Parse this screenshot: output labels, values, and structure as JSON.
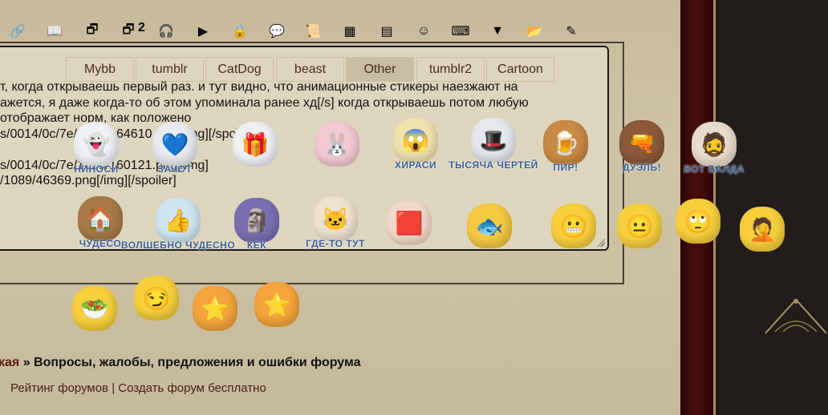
{
  "toolbar": {
    "icons": [
      "link-add-icon",
      "book-icon",
      "copy-icon",
      "copy-2-icon",
      "headphones-icon",
      "play-icon",
      "lock-icon",
      "speech-bubble-icon",
      "script-icon",
      "color-palette-icon",
      "table-icon",
      "smiley-icon",
      "keyboard-icon",
      "dropdown-arrow-icon",
      "folder-icon",
      "edit-image-icon"
    ],
    "glyphs": [
      "🔗",
      "📖",
      "🗗",
      "🗗",
      "🎧",
      "▶",
      "🔒",
      "💬",
      "📜",
      "▦",
      "▤",
      "☺",
      "⌨",
      "▼",
      "📂",
      "✎"
    ],
    "badge": "2"
  },
  "tabs": [
    {
      "label": "Mybb",
      "active": false
    },
    {
      "label": "tumblr",
      "active": false
    },
    {
      "label": "CatDog",
      "active": false
    },
    {
      "label": "beast",
      "active": false
    },
    {
      "label": "Other",
      "active": true
    },
    {
      "label": "tumblr2",
      "active": false
    },
    {
      "label": "Cartoon",
      "active": false
    }
  ],
  "editor": {
    "lines": [
      "т, когда открываешь первый раз. и тут видно, что анимационные стикеры наезжают на",
      "ажется, я даже когда-то об этом упоминала ранее хд[/s] когда открываешь потом любую",
      "отображает норм, как положено",
      "s/0014/0c/7e/1089/164610.png[/img][/spoiler]",
      "",
      "s/0014/0c/7e/1089/160121.png[/img]",
      "/1089/46369.png[/img][/spoiler]"
    ]
  },
  "stickers": [
    {
      "caption": "НИНОСИ",
      "glyph": "👻",
      "color": "#eef1f4"
    },
    {
      "caption": "ЗАЧОТ",
      "glyph": "💙",
      "color": "#e7ebef"
    },
    {
      "caption": "",
      "glyph": "🎁",
      "color": "#eef1f4"
    },
    {
      "caption": "",
      "glyph": "🐰",
      "color": "#f3c9d2"
    },
    {
      "caption": "ХИРАСИ",
      "glyph": "😱",
      "color": "#f1e3b0"
    },
    {
      "caption": "ТЫСЯЧА ЧЕРТЕЙ",
      "glyph": "🎩",
      "color": "#e5e9ee"
    },
    {
      "caption": "ПИР!",
      "glyph": "🍺",
      "color": "#c98a45"
    },
    {
      "caption": "ДУЭЛЬ!",
      "glyph": "🔫",
      "color": "#8b5a3a"
    },
    {
      "caption": "ВОТ БАЛДА",
      "glyph": "🧔",
      "color": "#e8dccb"
    },
    {
      "caption": "ЧУДЕСО",
      "glyph": "🏠",
      "color": "#a87a48"
    },
    {
      "caption": "ВОЛШЕБНО ЧУДЕСНО",
      "glyph": "👍",
      "color": "#cfe6f2"
    },
    {
      "caption": "КЕК",
      "glyph": "🗿",
      "color": "#7a6fb0"
    },
    {
      "caption": "ГДЕ-ТО ТУТ",
      "glyph": "🐱",
      "color": "#efe3cf"
    },
    {
      "caption": "",
      "glyph": "🟥",
      "color": "#f3d9c8"
    },
    {
      "caption": "",
      "glyph": "🐟",
      "color": "#f5c842"
    },
    {
      "caption": "",
      "glyph": "😬",
      "color": "#f7cf3d"
    },
    {
      "caption": "",
      "glyph": "😐",
      "color": "#f7cf3d"
    },
    {
      "caption": "",
      "glyph": "🙄",
      "color": "#f7cf3d"
    },
    {
      "caption": "",
      "glyph": "🤦",
      "color": "#f7cf3d"
    },
    {
      "caption": "",
      "glyph": "🥗",
      "color": "#f7cf3d"
    },
    {
      "caption": "",
      "glyph": "😏",
      "color": "#f7cf3d"
    },
    {
      "caption": "",
      "glyph": "⭐",
      "color": "#f5a53c"
    },
    {
      "caption": "",
      "glyph": "⭐",
      "color": "#f5a53c"
    }
  ],
  "breadcrumb": {
    "prev": "кая",
    "sep": " » ",
    "current": "Вопросы, жалобы, предложения и ошибки форума"
  },
  "footer": {
    "rating": "Рейтинг форумов",
    "sep": " | ",
    "create": "Создать форум бесплатно"
  }
}
